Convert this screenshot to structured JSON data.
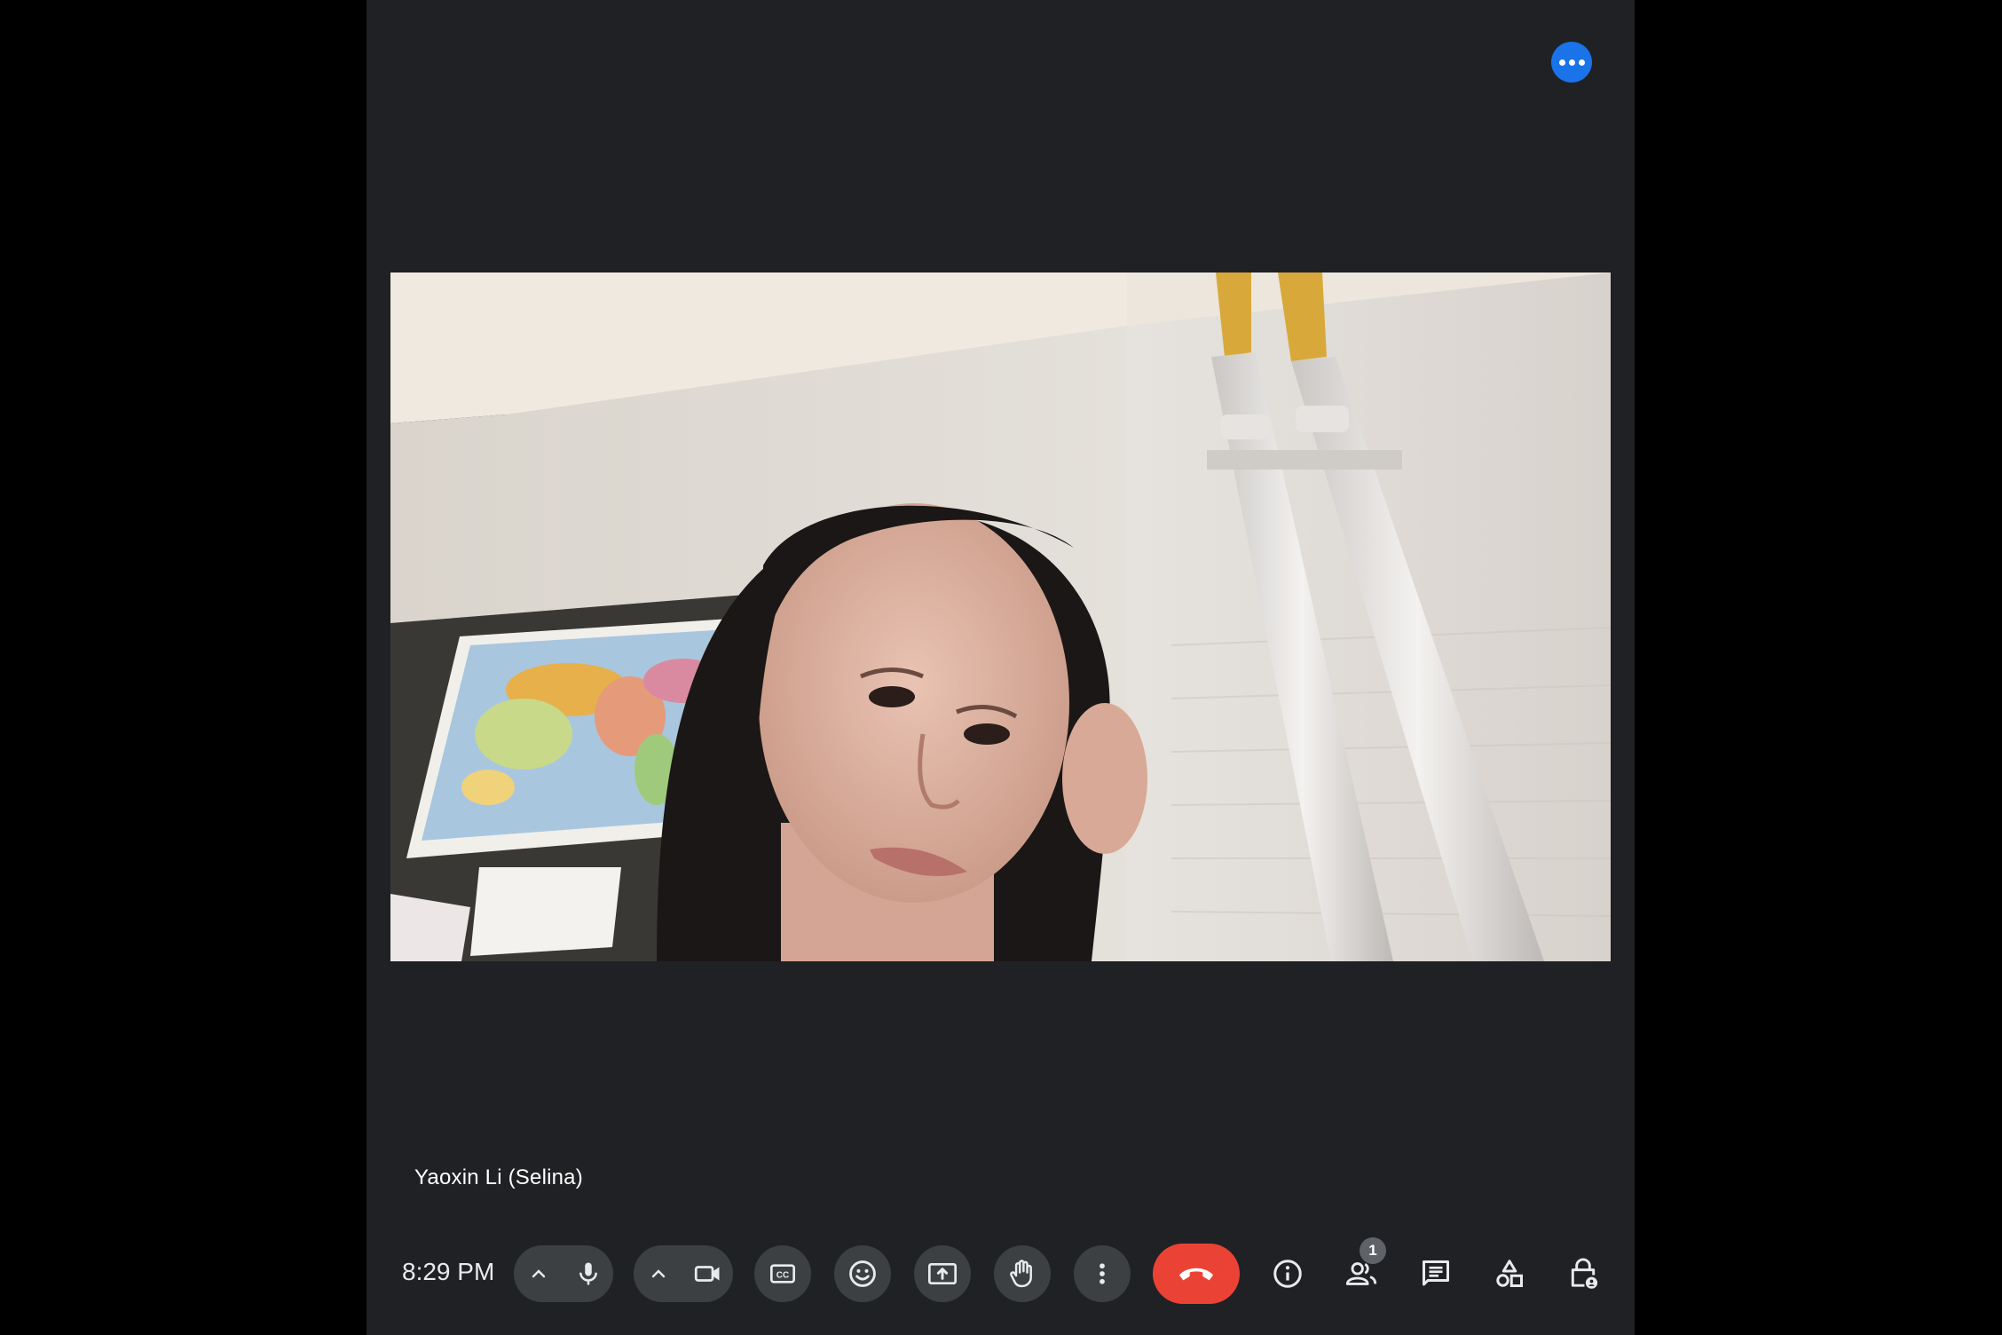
{
  "meeting": {
    "participant_name": "Yaoxin Li (Selina)",
    "clock": "8:29 PM",
    "participants_count": "1"
  },
  "icons": {
    "more_options": "more-horiz-icon",
    "audio_options": "chevron-up-icon",
    "microphone": "mic-icon",
    "video_options": "chevron-up-icon",
    "camera": "videocam-icon",
    "captions": "closed-caption-icon",
    "reactions": "emoji-icon",
    "present": "present-screen-icon",
    "raise_hand": "hand-icon",
    "more": "more-vert-icon",
    "leave": "call-end-icon",
    "info": "info-icon",
    "people": "people-icon",
    "chat": "chat-icon",
    "activities": "shapes-icon",
    "host_controls": "lock-person-icon"
  },
  "colors": {
    "window_bg": "#202124",
    "button_bg": "#3c4043",
    "hangup": "#ea4335",
    "accent": "#1a73e8",
    "icon": "#e8eaed"
  }
}
